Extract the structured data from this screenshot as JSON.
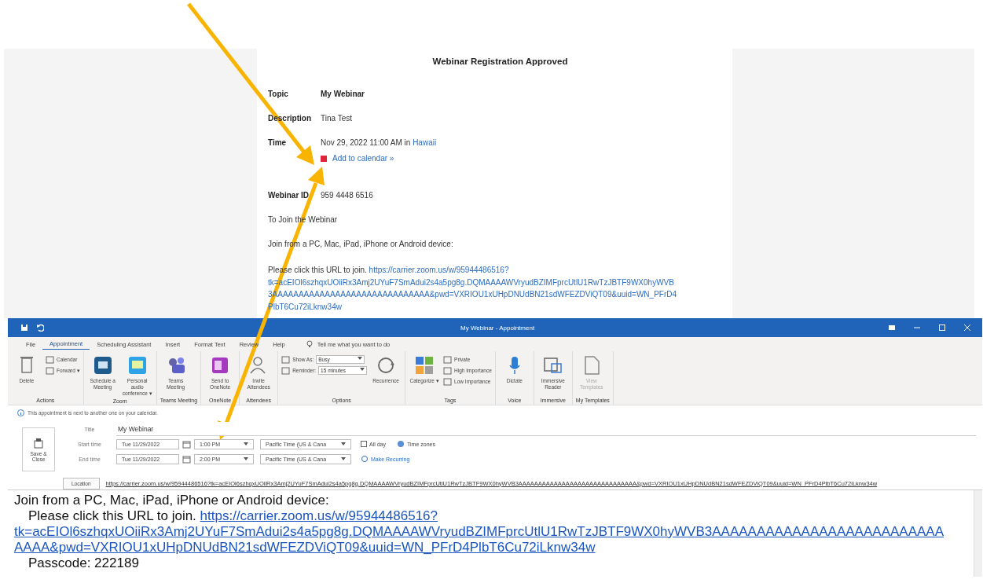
{
  "email": {
    "heading": "Webinar Registration Approved",
    "details": [
      {
        "kind": "bold",
        "label": "Topic",
        "value": "My Webinar"
      },
      {
        "kind": "plain",
        "label": "Description",
        "value": "Tina Test"
      },
      {
        "kind": "time",
        "label": "Time",
        "value": "Nov 29, 2022 11:00 AM in",
        "link": "Hawaii",
        "calendar_link": "Add to calendar »"
      },
      {
        "kind": "plain",
        "label": "Webinar ID",
        "value": "959 4448 6516"
      }
    ],
    "join_heading": "To Join the Webinar",
    "join_devices": "Join from a PC, Mac, iPad, iPhone or Android device:",
    "click_prompt": "Please click this URL to join.",
    "join_url_lines": [
      "https://carrier.zoom.us/w/95944486516?",
      "tk=acEIOl6szhqxUOiiRx3Amj2UYuF7SmAdui2s4a5pg8g.DQMAAAAWVryudBZIMFprcUtlU1RwTzJBTF9WX0hyWVB",
      "3AAAAAAAAAAAAAAAAAAAAAAAAAAAAAA&pwd=VXRIOU1xUHpDNUdBN21sdWFEZDViQT09&uuid=WN_PFrD4",
      "PlbT6Cu72iLknw34w"
    ]
  },
  "appointment": {
    "title": "My Webinar  -  Appointment",
    "tabs": [
      {
        "label": "File",
        "selected": false
      },
      {
        "label": "Appointment",
        "selected": true
      },
      {
        "label": "Scheduling Assistant",
        "selected": false
      },
      {
        "label": "Insert",
        "selected": false
      },
      {
        "label": "Format Text",
        "selected": false
      },
      {
        "label": "Review",
        "selected": false
      },
      {
        "label": "Help",
        "selected": false
      }
    ],
    "tell_me": "Tell me what you want to do",
    "ribbon_groups": [
      {
        "name": "Actions",
        "items": [
          {
            "kind": "large",
            "label": "Delete"
          },
          {
            "kind": "small",
            "label": "Calendar"
          },
          {
            "kind": "small",
            "label": "Forward  ▾"
          }
        ]
      },
      {
        "name": "Zoom",
        "items": [
          {
            "kind": "large",
            "label": "Schedule a Meeting"
          },
          {
            "kind": "large",
            "label": "Personal audio conference ▾"
          }
        ]
      },
      {
        "name": "Teams Meeting",
        "items": [
          {
            "kind": "large",
            "label": "Teams Meeting"
          }
        ]
      },
      {
        "name": "OneNote",
        "items": [
          {
            "kind": "large",
            "label": "Send to OneNote"
          }
        ]
      },
      {
        "name": "Attendees",
        "items": [
          {
            "kind": "large",
            "label": "Invite Attendees"
          }
        ]
      },
      {
        "name": "Options",
        "items": [
          {
            "kind": "select",
            "label": "Show As:",
            "value": "Busy"
          },
          {
            "kind": "select",
            "label": "Reminder:",
            "value": "15 minutes"
          },
          {
            "kind": "large",
            "label": "Recurrence"
          }
        ]
      },
      {
        "name": "Tags",
        "items": [
          {
            "kind": "large",
            "label": "Categorize ▾"
          },
          {
            "kind": "small",
            "label": "Private"
          },
          {
            "kind": "small",
            "label": "High Importance"
          },
          {
            "kind": "small",
            "label": "Low Importance"
          }
        ]
      },
      {
        "name": "Voice",
        "items": [
          {
            "kind": "large",
            "label": "Dictate"
          }
        ]
      },
      {
        "name": "Immersive",
        "items": [
          {
            "kind": "large",
            "label": "Immersive Reader"
          }
        ]
      },
      {
        "name": "My Templates",
        "items": [
          {
            "kind": "large",
            "label": "View Templates",
            "disabled": true
          }
        ]
      }
    ],
    "info": "This appointment is next to another one on your calendar.",
    "save_close": "Save & Close",
    "title_label": "Title",
    "title_value": "My Webinar",
    "times": [
      {
        "label": "Start time",
        "date": "Tue 11/29/2022",
        "time": "1:00 PM",
        "zone": "Pacific Time (US & Cana"
      },
      {
        "label": "End time",
        "date": "Tue 11/29/2022",
        "time": "2:00 PM",
        "zone": "Pacific Time (US & Cana"
      }
    ],
    "all_day": {
      "label": "All day",
      "checked": false
    },
    "time_zones": "Time zones",
    "make_recurring": "Make Recurring",
    "location_button": "Location",
    "location_value": "https://carrier.zoom.us/w/95944486516?tk=acEIOl6szhqxUOiiRx3Amj2UYuF7SmAdui2s4a5pg8g.DQMAAAAWVryudBZIMFprcUtlU1RwTzJBTF9WX0hyWVB3AAAAAAAAAAAAAAAAAAAAAAAAAAAAAA&pwd=VXRIOU1xUHpDNUdBN21sdWFEZDViQT09&uuid=WN_PFrD4PlbT6Cu72iLknw34w",
    "body": {
      "devices": "Join from a PC, Mac, iPad, iPhone or Android device:",
      "click_prompt": "Please click this URL to join.",
      "url_lines": [
        "https://carrier.zoom.us/w/95944486516?",
        "tk=acEIOl6szhqxUOiiRx3Amj2UYuF7SmAdui2s4a5pg8g.DQMAAAAWVryudBZIMFprcUtlU1RwTzJBTF9WX0hyWVB3AAAAAAAAAAAAAAAAAAAAAAAAAA",
        "AAAA&pwd=VXRIOU1xUHpDNUdBN21sdWFEZDViQT09&uuid=WN_PFrD4PlbT6Cu72iLknw34w"
      ],
      "passcode": "Passcode: 222189"
    }
  }
}
